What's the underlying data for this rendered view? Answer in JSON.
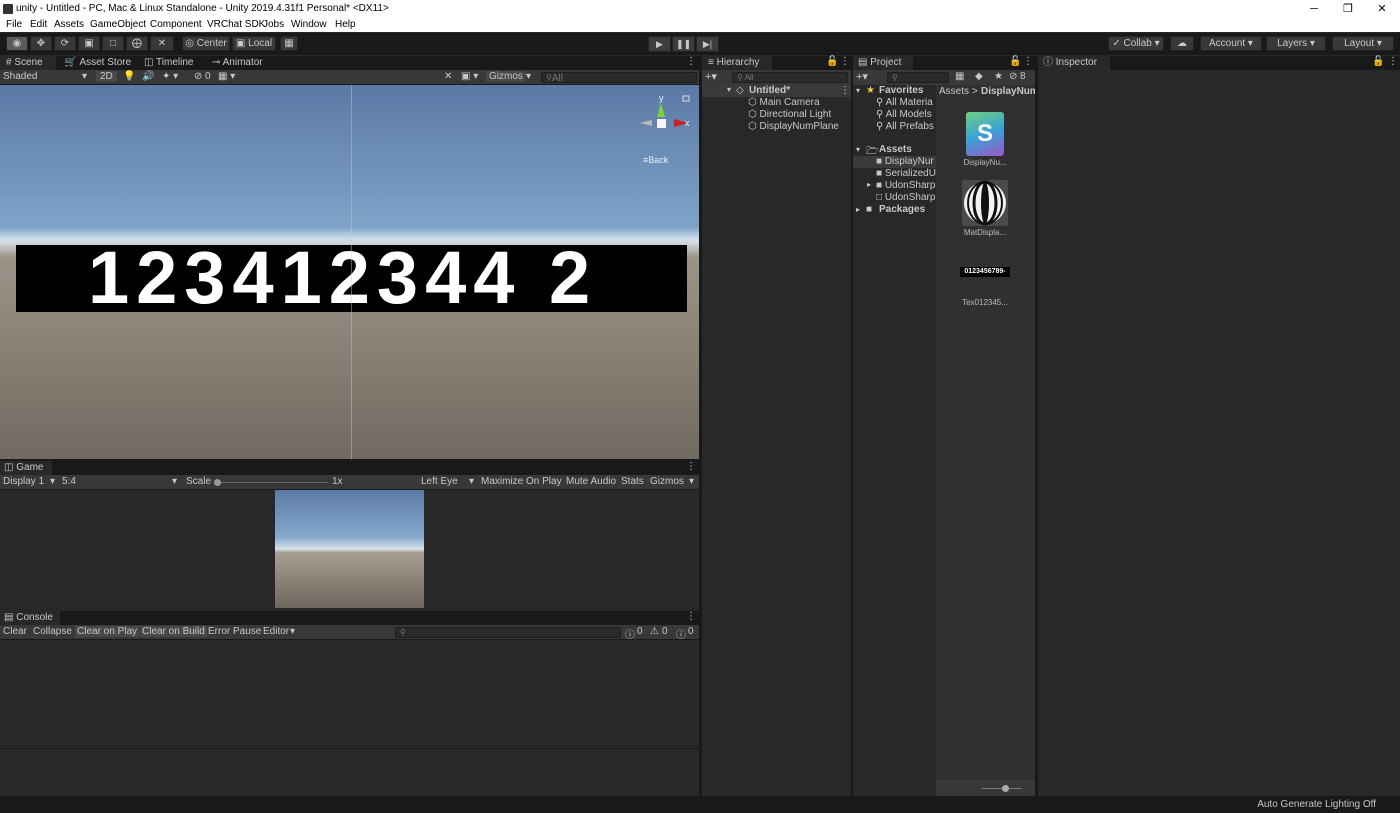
{
  "window": {
    "title": "unity - Untitled - PC, Mac & Linux Standalone - Unity 2019.4.31f1 Personal* <DX11>",
    "controls": [
      "─",
      "❐",
      "✕"
    ]
  },
  "menu": [
    "File",
    "Edit",
    "Assets",
    "GameObject",
    "Component",
    "VRChat SDK",
    "Jobs",
    "Window",
    "Help"
  ],
  "toolbar": {
    "center_label": "Center",
    "local_label": "Local",
    "collab_label": "Collab",
    "account_label": "Account",
    "layers_label": "Layers",
    "layout_label": "Layout"
  },
  "scene_tabs": [
    "Scene",
    "Asset Store",
    "Timeline",
    "Animator"
  ],
  "scene_bar": {
    "shading": "Shaded",
    "mode_2d": "2D",
    "hidden_count": "0",
    "gizmos": "Gizmos",
    "search_placeholder": "All"
  },
  "scene": {
    "digits": "123412344 2",
    "back_label": "Back",
    "axis_y": "y",
    "axis_x": "x"
  },
  "game": {
    "tab": "Game",
    "display": "Display 1",
    "aspect": "5:4",
    "scale_label": "Scale",
    "scale_value": "1x",
    "eye": "Left Eye",
    "maximize": "Maximize On Play",
    "mute": "Mute Audio",
    "stats": "Stats",
    "gizmos": "Gizmos"
  },
  "console": {
    "tab": "Console",
    "clear": "Clear",
    "collapse": "Collapse",
    "clear_on_play": "Clear on Play",
    "clear_on_build": "Clear on Build",
    "error_pause": "Error Pause",
    "editor": "Editor",
    "info_count": "0",
    "warn_count": "0",
    "error_count": "0"
  },
  "hierarchy": {
    "tab": "Hierarchy",
    "search_placeholder": "All",
    "scene_name": "Untitled*",
    "items": [
      "Main Camera",
      "Directional Light",
      "DisplayNumPlane"
    ]
  },
  "project": {
    "tab": "Project",
    "hidden_count": "8",
    "favorites_label": "Favorites",
    "favorites": [
      "All Materia",
      "All Models",
      "All Prefabs"
    ],
    "assets_label": "Assets",
    "asset_folders": [
      "DisplayNur",
      "SerializedU",
      "UdonSharp",
      "UdonSharp"
    ],
    "packages_label": "Packages",
    "breadcrumb_root": "Assets",
    "breadcrumb_sep": ">",
    "breadcrumb_current": "DisplayNum",
    "assets": [
      {
        "name": "DisplayNu...",
        "icon": "S"
      },
      {
        "name": "MatDispla..."
      },
      {
        "name": "Tex012345...",
        "preview_text": "0123456789-"
      }
    ]
  },
  "inspector": {
    "tab": "Inspector"
  },
  "status": {
    "text": "Auto Generate Lighting Off"
  },
  "colors": {
    "editor_bg": "#282828",
    "toolbar_bg": "#191919",
    "panel_header": "#383838",
    "x_axis": "#d01f1f",
    "y_axis": "#7cd33b",
    "favorites_star": "#f4c64a"
  }
}
